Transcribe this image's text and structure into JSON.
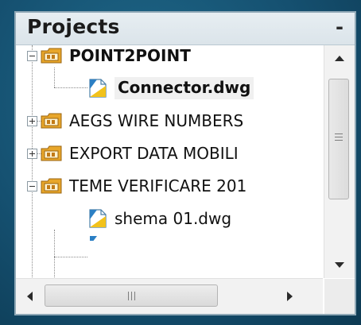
{
  "panel": {
    "title": "Projects",
    "minimize_label": "-"
  },
  "tree": {
    "nodes": [
      {
        "label": "POINT2POINT",
        "type": "project",
        "state": "expanded"
      },
      {
        "label": "Connector.dwg",
        "type": "drawing",
        "selected": true
      },
      {
        "label": "AEGS WIRE NUMBERS",
        "type": "project",
        "state": "collapsed"
      },
      {
        "label": "EXPORT DATA MOBILI",
        "type": "project",
        "state": "collapsed"
      },
      {
        "label": "TEME VERIFICARE 201",
        "type": "project",
        "state": "expanded"
      },
      {
        "label": "shema 01.dwg",
        "type": "drawing",
        "selected": false
      }
    ]
  },
  "scrollbars": {
    "vertical": {
      "up_icon": "arrow-up-icon",
      "down_icon": "arrow-down-icon",
      "grip_icon": "grip-icon"
    },
    "horizontal": {
      "left_icon": "arrow-left-icon",
      "right_icon": "arrow-right-icon",
      "grip_icon": "grip-icon"
    }
  },
  "colors": {
    "frame": "#1b5a78",
    "folder": "#e8a62a",
    "drawing": "#2b7fc4",
    "selection": "#f0f0f0"
  }
}
